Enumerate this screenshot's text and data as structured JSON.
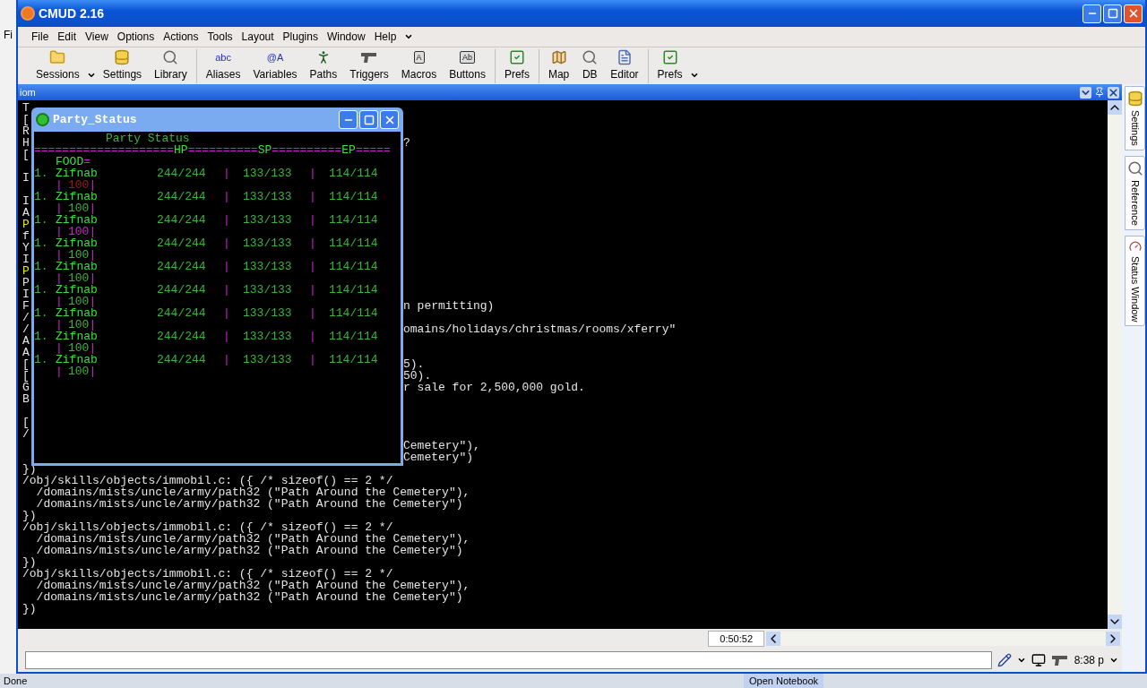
{
  "background_app": {
    "menu_fragment": "Fi",
    "status_fragment": "Done"
  },
  "taskbar": {
    "item": "Open Notebook"
  },
  "window": {
    "title": "CMUD 2.16"
  },
  "menu": [
    "File",
    "Edit",
    "View",
    "Options",
    "Actions",
    "Tools",
    "Layout",
    "Plugins",
    "Window",
    "Help"
  ],
  "toolbar": {
    "groups": [
      [
        {
          "label": "Sessions",
          "has_menu": true
        },
        {
          "label": "Settings"
        },
        {
          "label": "Library"
        }
      ],
      [
        {
          "label": "Aliases",
          "icon_text": "abc"
        },
        {
          "label": "Variables",
          "icon_text": "@A"
        },
        {
          "label": "Paths"
        },
        {
          "label": "Triggers"
        },
        {
          "label": "Macros",
          "icon_text": "A"
        },
        {
          "label": "Buttons",
          "icon_text": "Ab"
        }
      ],
      [
        {
          "label": "Prefs"
        }
      ],
      [
        {
          "label": "Map"
        },
        {
          "label": "DB"
        },
        {
          "label": "Editor"
        }
      ],
      [
        {
          "label": "Prefs",
          "has_menu": true
        }
      ]
    ]
  },
  "session": {
    "title": "iom"
  },
  "terminal": {
    "lines": [
      {
        "kind": "split",
        "left": "T"
      },
      {
        "kind": "split",
        "left": "["
      },
      {
        "kind": "split",
        "left": "R"
      },
      {
        "kind": "split",
        "left": "H",
        "right": "?"
      },
      {
        "kind": "split",
        "left": "["
      },
      {
        "kind": "blank"
      },
      {
        "kind": "split",
        "left": "I"
      },
      {
        "kind": "blank"
      },
      {
        "kind": "split",
        "left": "I"
      },
      {
        "kind": "split",
        "left": "A"
      },
      {
        "kind": "split",
        "left": "P",
        "color": "#e8e800"
      },
      {
        "kind": "split",
        "left": "f"
      },
      {
        "kind": "split",
        "left": "Y"
      },
      {
        "kind": "split",
        "left": "I"
      },
      {
        "kind": "split",
        "left": "P",
        "color": "#e8e800"
      },
      {
        "kind": "split",
        "left": "P"
      },
      {
        "kind": "split",
        "left": "I"
      },
      {
        "kind": "split",
        "left": "F",
        "right": "n permitting)"
      },
      {
        "kind": "split",
        "left": "/"
      },
      {
        "kind": "split",
        "left": "/",
        "right": "omains/holidays/christmas/rooms/xferry\""
      },
      {
        "kind": "split",
        "left": "A"
      },
      {
        "kind": "split",
        "left": "A"
      },
      {
        "kind": "split",
        "left": "[",
        "right": "5)."
      },
      {
        "kind": "split",
        "left": "[",
        "right": "50)."
      },
      {
        "kind": "split",
        "left": "G",
        "right": "r sale for 2,500,000 gold."
      },
      {
        "kind": "split",
        "left": "B"
      },
      {
        "kind": "blank"
      },
      {
        "kind": "split",
        "left": "["
      },
      {
        "kind": "split",
        "left": "/"
      },
      {
        "kind": "split",
        "right": "Cemetery\"),"
      },
      {
        "kind": "split",
        "right": "Cemetery\")"
      },
      {
        "kind": "full",
        "text": "})"
      },
      {
        "kind": "full",
        "text": "/obj/skills/objects/immobil.c: ({ /* sizeof() == 2 */"
      },
      {
        "kind": "full",
        "text": "  /domains/mists/uncle/army/path32 (\"Path Around the Cemetery\"),"
      },
      {
        "kind": "full",
        "text": "  /domains/mists/uncle/army/path32 (\"Path Around the Cemetery\")"
      },
      {
        "kind": "full",
        "text": "})"
      },
      {
        "kind": "full",
        "text": "/obj/skills/objects/immobil.c: ({ /* sizeof() == 2 */"
      },
      {
        "kind": "full",
        "text": "  /domains/mists/uncle/army/path32 (\"Path Around the Cemetery\"),"
      },
      {
        "kind": "full",
        "text": "  /domains/mists/uncle/army/path32 (\"Path Around the Cemetery\")"
      },
      {
        "kind": "full",
        "text": "})"
      },
      {
        "kind": "full",
        "text": "/obj/skills/objects/immobil.c: ({ /* sizeof() == 2 */"
      },
      {
        "kind": "full",
        "text": "  /domains/mists/uncle/army/path32 (\"Path Around the Cemetery\"),"
      },
      {
        "kind": "full",
        "text": "  /domains/mists/uncle/army/path32 (\"Path Around the Cemetery\")"
      },
      {
        "kind": "full",
        "text": "})"
      }
    ]
  },
  "party_window": {
    "title": "Party_Status",
    "heading": "Party Status",
    "rule": [
      {
        "kind": "fill",
        "text": "===================="
      },
      {
        "kind": "label",
        "text": "HP"
      },
      {
        "kind": "fill",
        "text": "=========="
      },
      {
        "kind": "label",
        "text": "SP"
      },
      {
        "kind": "fill",
        "text": "=========="
      },
      {
        "kind": "label",
        "text": "EP"
      },
      {
        "kind": "fill",
        "text": "====="
      }
    ],
    "food_label": "FOOD",
    "food_mark": "=",
    "separator": "|",
    "members": [
      {
        "num": "1.",
        "name": "Zifnab",
        "hp": "244/244",
        "sp": "133/133",
        "ep": "114/114",
        "food": "100",
        "color": "#a01818"
      },
      {
        "num": "1.",
        "name": "Zifnab",
        "hp": "244/244",
        "sp": "133/133",
        "ep": "114/114",
        "food": "100",
        "color": "#3cb43c"
      },
      {
        "num": "1.",
        "name": "Zifnab",
        "hp": "244/244",
        "sp": "133/133",
        "ep": "114/114",
        "food": "100",
        "color": "#d020d0"
      },
      {
        "num": "1.",
        "name": "Zifnab",
        "hp": "244/244",
        "sp": "133/133",
        "ep": "114/114",
        "food": "100",
        "color": "#3cb43c"
      },
      {
        "num": "1.",
        "name": "Zifnab",
        "hp": "244/244",
        "sp": "133/133",
        "ep": "114/114",
        "food": "100",
        "color": "#3cb43c"
      },
      {
        "num": "1.",
        "name": "Zifnab",
        "hp": "244/244",
        "sp": "133/133",
        "ep": "114/114",
        "food": "100",
        "color": "#3cb43c"
      },
      {
        "num": "1.",
        "name": "Zifnab",
        "hp": "244/244",
        "sp": "133/133",
        "ep": "114/114",
        "food": "100",
        "color": "#3cb43c"
      },
      {
        "num": "1.",
        "name": "Zifnab",
        "hp": "244/244",
        "sp": "133/133",
        "ep": "114/114",
        "food": "100",
        "color": "#3cb43c"
      },
      {
        "num": "1.",
        "name": "Zifnab",
        "hp": "244/244",
        "sp": "133/133",
        "ep": "114/114",
        "food": "100",
        "color": "#3cb43c"
      }
    ]
  },
  "dock_tabs": [
    {
      "label": "Settings"
    },
    {
      "label": "Reference"
    },
    {
      "label": "Status Window"
    }
  ],
  "status_row": {
    "timer": "0:50:52"
  },
  "command_row": {
    "clock": "8:38 p"
  }
}
